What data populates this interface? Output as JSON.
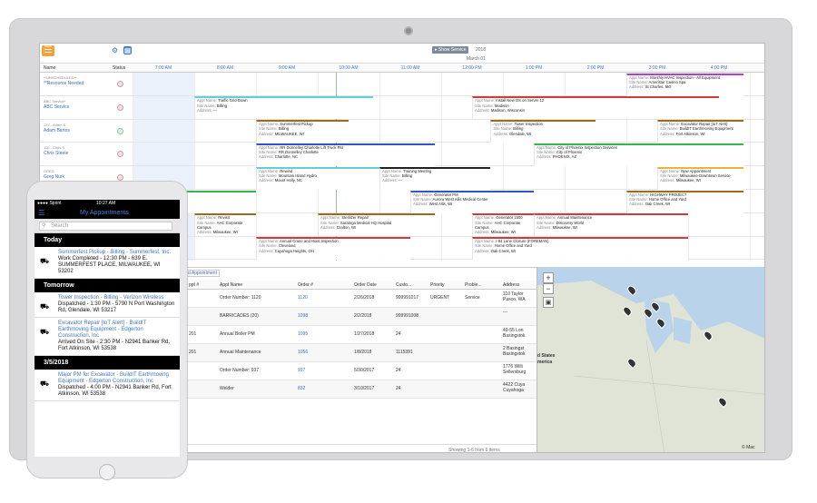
{
  "desktop": {
    "toolbar": {
      "show_service_label": "▸ Show Service",
      "date": "2018",
      "month": "March 01"
    },
    "scheduler": {
      "col_name": "Name",
      "col_status": "Status",
      "times": [
        "7:00 AM",
        "8:00 AM",
        "9:00 AM",
        "10:00 AM",
        "11:00 AM",
        "12:00 PM",
        "1:00 PM",
        "2:00 PM",
        "3:00 PM",
        "4:00 PM"
      ],
      "resources": [
        {
          "sub": "**UNSCHEDULED**",
          "name": "**Resource Needed",
          "ok": false
        },
        {
          "sub": "ABC Service*",
          "name": "ABC Service",
          "ok": false
        },
        {
          "sub": "137 - Adam S",
          "name": "Adam Bartos",
          "ok": true
        },
        {
          "sub": "110 - Chris S",
          "name": "Chris Steele",
          "ok": false
        },
        {
          "sub": "GREG",
          "name": "Greg Nurk",
          "ok": false
        },
        {
          "sub": "",
          "name": "",
          "ok": false
        },
        {
          "sub": "",
          "name": "",
          "ok": false
        },
        {
          "sub": "",
          "name": "",
          "ok": false
        }
      ],
      "appointments": [
        {
          "row": 0,
          "start": 15.0,
          "end": 16.9,
          "color": "#b13fd3",
          "name": "Monthly HVAC Inspection - All Equipment",
          "site": "Ameristar Casino Spa",
          "addr": "St Charles, MO"
        },
        {
          "row": 1,
          "start": 8.0,
          "end": 10.9,
          "color": "#5fd0d6",
          "name": "Traffic Grid Down",
          "site": "Billing",
          "addr": "---"
        },
        {
          "row": 1,
          "start": 12.5,
          "end": 16.5,
          "color": "#d13b3b",
          "name": "Install New OS on Server 12",
          "site": "Madison",
          "addr": "Madison, Wisconsin"
        },
        {
          "row": 2,
          "start": 9.0,
          "end": 10.5,
          "color": "#a06a1e",
          "name": "Summerfest Pickup",
          "site": "Billing",
          "addr": "MILWAUKEE, WI"
        },
        {
          "row": 2,
          "start": 12.8,
          "end": 14.5,
          "color": "#a06a1e",
          "name": "Tower Inspection",
          "site": "Billing",
          "addr": "Glendale, WI"
        },
        {
          "row": 2,
          "start": 15.5,
          "end": 16.9,
          "color": "#a06a1e",
          "name": "Excavator Repair [IoT Alert]",
          "site": "BuildIT Earthmoving Equipment",
          "addr": "Fort Atkinson, WI"
        },
        {
          "row": 3,
          "start": 9.0,
          "end": 11.9,
          "color": "#2f55c8",
          "name": "RR Donnelley Charlotte Lift Truck PM",
          "site": "RR Donnelley Charlotte",
          "addr": "Charlotte, NC"
        },
        {
          "row": 3,
          "start": 13.5,
          "end": 16.9,
          "color": "#35b54a",
          "name": "City of Phoenix Inspection Services",
          "site": "City of Phoenix",
          "addr": "PHOENIX, AZ"
        },
        {
          "row": 4,
          "start": 9.0,
          "end": 11.0,
          "color": "#5fd0d6",
          "name": "Rewind",
          "site": "Mountain Island Hydro",
          "addr": "Mount Holly, NC"
        },
        {
          "row": 4,
          "start": 11.0,
          "end": 12.8,
          "color": "#222",
          "name": "Training Meeting",
          "site": "Billing",
          "addr": "---"
        },
        {
          "row": 4,
          "start": 15.5,
          "end": 16.9,
          "color": "#e2b83a",
          "name": "New Appointment",
          "site": "Milwaukee-Downtown Service",
          "addr": "Milwaukee, WI"
        },
        {
          "row": 5,
          "start": 7.0,
          "end": 9.0,
          "color": "#35b54a",
          "name": "Pure (CREW)",
          "site": "and Yard",
          "addr": ""
        },
        {
          "row": 5,
          "start": 11.5,
          "end": 13.5,
          "color": "#2f55c8",
          "name": "Generator PM",
          "site": "Aurora West Allis Medical Center",
          "addr": "West Allis, WI"
        },
        {
          "row": 5,
          "start": 15.0,
          "end": 16.9,
          "color": "#a06a1e",
          "name": "HIGHWAY PROJECT",
          "site": "Home Office and Yard",
          "addr": "Oak Creek, WI"
        },
        {
          "row": 6,
          "start": 8.0,
          "end": 9.0,
          "color": "#a06a1e",
          "name": "Revisit",
          "site": "AHC Corporate Campus",
          "addr": "Milwaukee, WI"
        },
        {
          "row": 6,
          "start": 10.0,
          "end": 11.9,
          "color": "#a06a1e",
          "name": "Sterilizer Repair",
          "site": "Saratoga Medical HQ Hospital",
          "addr": "Grafton, WI"
        },
        {
          "row": 6,
          "start": 12.5,
          "end": 13.5,
          "color": "#d13b3b",
          "name": "Generator 1500",
          "site": "AHC Corporate Campus",
          "addr": "Milwaukee, WI"
        },
        {
          "row": 6,
          "start": 13.5,
          "end": 16.0,
          "color": "#d13b3b",
          "name": "Annual Maintenance",
          "site": "Discovery World",
          "addr": "Milwaukee, WI"
        },
        {
          "row": 7,
          "start": 9.0,
          "end": 11.5,
          "color": "#d13b3b",
          "name": "Annual Crane and Hoist Inspection",
          "site": "Cleveland",
          "addr": "Cuyahoga Heights, OH"
        },
        {
          "row": 7,
          "start": 12.5,
          "end": 16.0,
          "color": "#d13b3b",
          "name": "I-94 Lane Closure (FOREMAN)",
          "site": "Home Office and Yard",
          "addr": "Oak Creek, WI"
        }
      ],
      "label_name": "Appt Name:",
      "label_site": "Site Name:",
      "label_addr": "Address:"
    },
    "grid": {
      "add_label": "d Appointment",
      "headers": [
        "ppt #",
        "Appt Name",
        "Order #",
        "Order Date",
        "Custo...",
        "Priority",
        "Proble...",
        "Address"
      ],
      "rows": [
        [
          "",
          "Order Number: 1120",
          "1120",
          "2/26/2018",
          "999991017",
          "URGENT",
          "Service",
          "110 Taylor Pasco, WA"
        ],
        [
          "",
          "BARRICADES (20)",
          "1098",
          "2/2/2018",
          "999991008",
          "",
          "",
          "---"
        ],
        [
          "201",
          "Annual Boiler PM",
          "1095",
          "1/27/2018",
          "24",
          "",
          "",
          "49-55 Lon Basingstok"
        ],
        [
          "201",
          "Annual Maintenance",
          "1056",
          "1/8/2018",
          "1115391",
          "",
          "",
          "2 Basingst Basingstok"
        ],
        [
          "",
          "Order Number: 937",
          "937",
          "5/30/2017",
          "24",
          "",
          "",
          "1776 Willi Sellersburg"
        ],
        [
          "",
          "Welder",
          "832",
          "3/10/2017",
          "24",
          "",
          "",
          "4422 Cuya Cuyahoga"
        ]
      ],
      "footer": "Showing 1-6 from 6 items"
    },
    "map": {
      "label_us": "d States",
      "label_am": "merica",
      "credit": "© Mac"
    }
  },
  "mobile": {
    "carrier": "●●●● Sprint",
    "time": "10:27 AM",
    "title": "My Appointments",
    "search_placeholder": "Search",
    "sections": [
      {
        "label": "Today",
        "items": [
          {
            "title": "Summerfest Pickup - Billing - Summerfest, Inc.",
            "status": "Work Completed - 12:30 PM - 639 E. SUMMERFEST PLACE, MILWAUKEE, WI 53202"
          }
        ]
      },
      {
        "label": "Tomorrow",
        "items": [
          {
            "title": "Tower Inspection - Billing - Verizon Wireless",
            "status": "Dispatched - 1:30 PM - 5790 N Port Washington Rd, Glendale, WI 53217"
          },
          {
            "title": "Excavator Repair [IoT Alert] - BuildIT Earthmoving Equipment - Edgerton Construction, Inc",
            "status": "Arrived On Site - 2:30 PM - N2941 Banker Rd, Fort Atkinson, WI 53538"
          }
        ]
      },
      {
        "label": "3/5/2018",
        "items": [
          {
            "title": "Major PM for Excavator - BuildIT Earthmoving Equipment - Edgerton Construction, Inc",
            "status": "Dispatched - 4:00 PM - N2941 Banker Rd, Fort Atkinson, WI 53538"
          }
        ]
      }
    ]
  }
}
